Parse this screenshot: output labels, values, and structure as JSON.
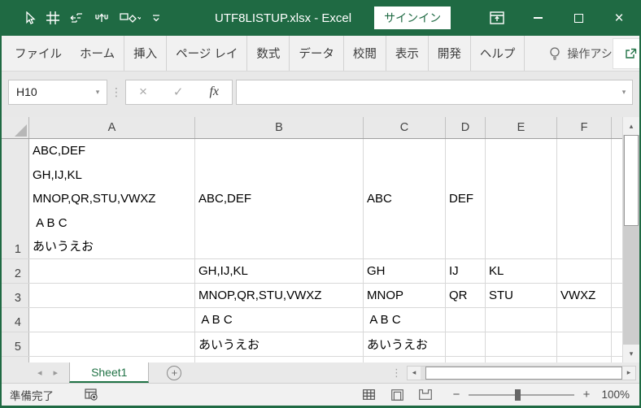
{
  "title_bar": {
    "title": "UTF8LISTUP.xlsx  -  Excel",
    "sign_in_label": "サインイン"
  },
  "ribbon": {
    "tabs": [
      "ファイル",
      "ホーム",
      "挿入",
      "ページ レイ",
      "数式",
      "データ",
      "校閲",
      "表示",
      "開発",
      "ヘルプ"
    ],
    "assist_label": "操作アシ",
    "share_label": "共有"
  },
  "formula_bar": {
    "name_box_value": "H10",
    "fx_label": "fx",
    "formula_value": ""
  },
  "grid": {
    "column_headers": [
      "A",
      "B",
      "C",
      "D",
      "E",
      "F"
    ],
    "rows": [
      {
        "num": "1",
        "cells": {
          "A": "ABC,DEF\nGH,IJ,KL\nMNOP,QR,STU,VWXZ\n A B C\nあいうえお",
          "B": "ABC,DEF",
          "C": "ABC",
          "D": "DEF",
          "E": "",
          "F": ""
        }
      },
      {
        "num": "2",
        "cells": {
          "A": "",
          "B": "GH,IJ,KL",
          "C": "GH",
          "D": "IJ",
          "E": "KL",
          "F": ""
        }
      },
      {
        "num": "3",
        "cells": {
          "A": "",
          "B": "MNOP,QR,STU,VWXZ",
          "C": "MNOP",
          "D": "QR",
          "E": "STU",
          "F": "VWXZ"
        }
      },
      {
        "num": "4",
        "cells": {
          "A": "",
          "B": " A B C",
          "C": " A B C",
          "D": "",
          "E": "",
          "F": ""
        }
      },
      {
        "num": "5",
        "cells": {
          "A": "",
          "B": "あいうえお",
          "C": "あいうえお",
          "D": "",
          "E": "",
          "F": ""
        }
      }
    ]
  },
  "sheet_bar": {
    "active_sheet": "Sheet1"
  },
  "status_bar": {
    "mode": "準備完了",
    "zoom_level": "100%"
  },
  "colors": {
    "title_bar_green": "#1f6a43",
    "accent_green": "#217346"
  },
  "glyphs": {
    "dropdown": "▾",
    "cancel": "×",
    "check": "✓",
    "separator_dots": "⋮",
    "nav_left": "◂",
    "nav_right": "▸",
    "add_sheet": "+",
    "scroll_up": "▴",
    "scroll_down": "▾",
    "scroll_left": "◂",
    "scroll_right": "▸",
    "zoom_out": "−",
    "zoom_in": "+",
    "close": "×"
  }
}
